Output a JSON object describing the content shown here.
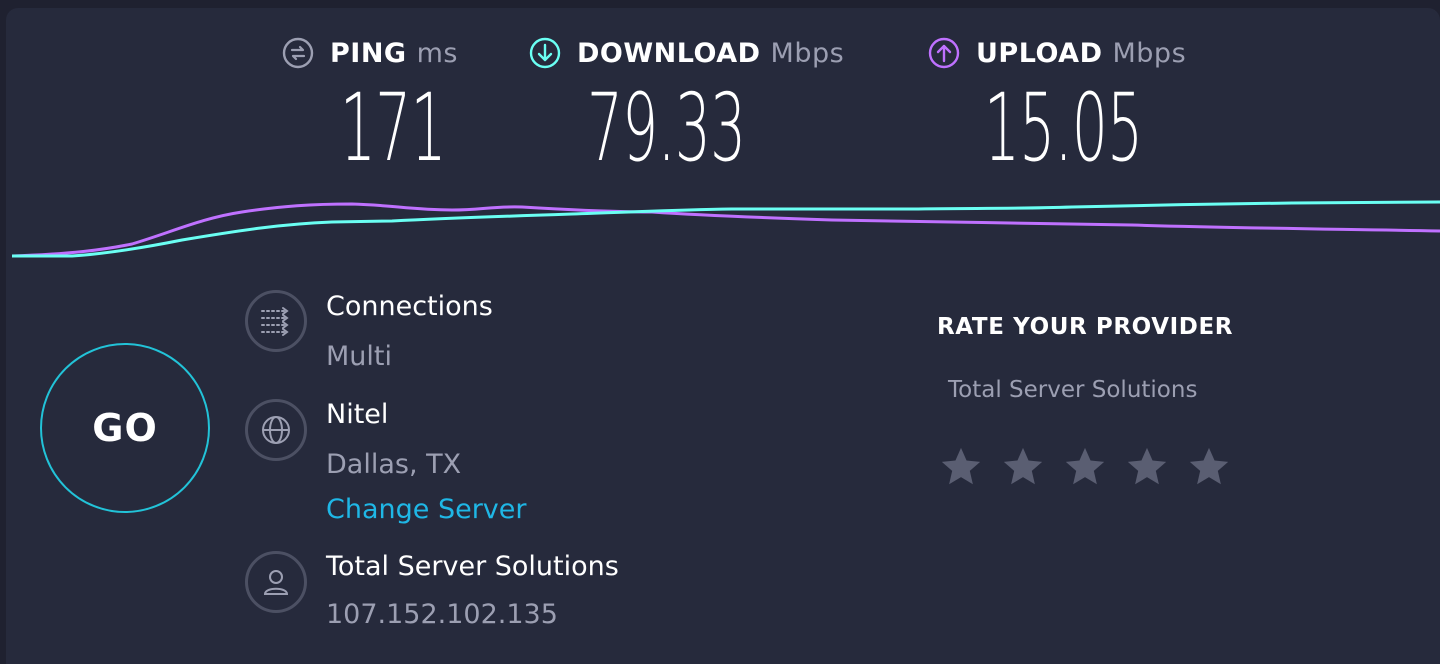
{
  "metrics": {
    "ping": {
      "label": "PING",
      "unit": "ms",
      "value": "171",
      "icon": "ping-icon",
      "color": "#9c9fb2"
    },
    "download": {
      "label": "DOWNLOAD",
      "unit": "Mbps",
      "value": "79.33",
      "icon": "download-arrow-icon",
      "color": "#6afff3"
    },
    "upload": {
      "label": "UPLOAD",
      "unit": "Mbps",
      "value": "15.05",
      "icon": "upload-arrow-icon",
      "color": "#bf71ff"
    }
  },
  "go_button": {
    "label": "GO",
    "color": "#22c3d8"
  },
  "connections": {
    "title": "Connections",
    "value": "Multi",
    "icon": "connections-arrows-icon"
  },
  "server": {
    "name": "Nitel",
    "location": "Dallas, TX",
    "change_label": "Change Server",
    "icon": "globe-icon"
  },
  "provider": {
    "name": "Total Server Solutions",
    "ip": "107.152.102.135",
    "icon": "user-icon"
  },
  "rate": {
    "title": "RATE YOUR PROVIDER",
    "provider_name": "Total Server Solutions",
    "stars_total": 5,
    "stars_selected": 0,
    "star_color": "#5a5e72"
  },
  "colors": {
    "background": "#262a3c",
    "accent_link": "#1fb7e6",
    "muted_text": "#9c9fb2"
  }
}
